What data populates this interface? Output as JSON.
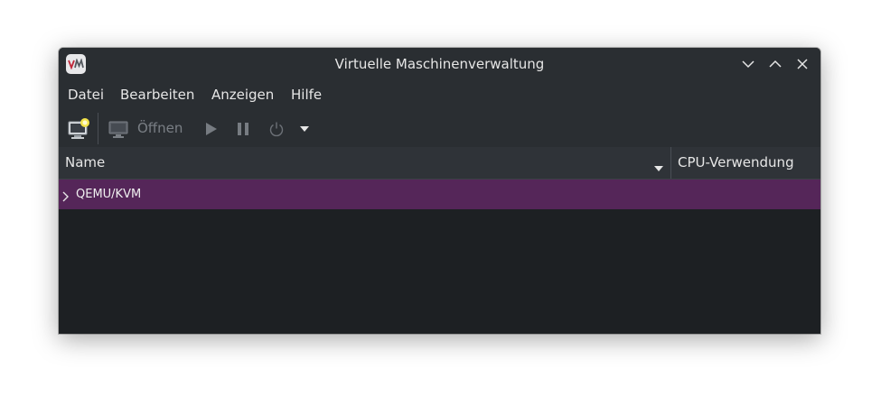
{
  "window": {
    "title": "Virtuelle Maschinenverwaltung",
    "app_icon_text": "VM"
  },
  "menu": {
    "items": [
      "Datei",
      "Bearbeiten",
      "Anzeigen",
      "Hilfe"
    ]
  },
  "toolbar": {
    "open_label": "Öffnen"
  },
  "table": {
    "columns": [
      "Name",
      "CPU-Verwendung"
    ],
    "rows": [
      {
        "label": "QEMU/KVM",
        "expanded": false,
        "selected": true
      }
    ]
  },
  "colors": {
    "titlebar": "#2a2e32",
    "list_background": "#1d2023",
    "selection": "#552659"
  }
}
